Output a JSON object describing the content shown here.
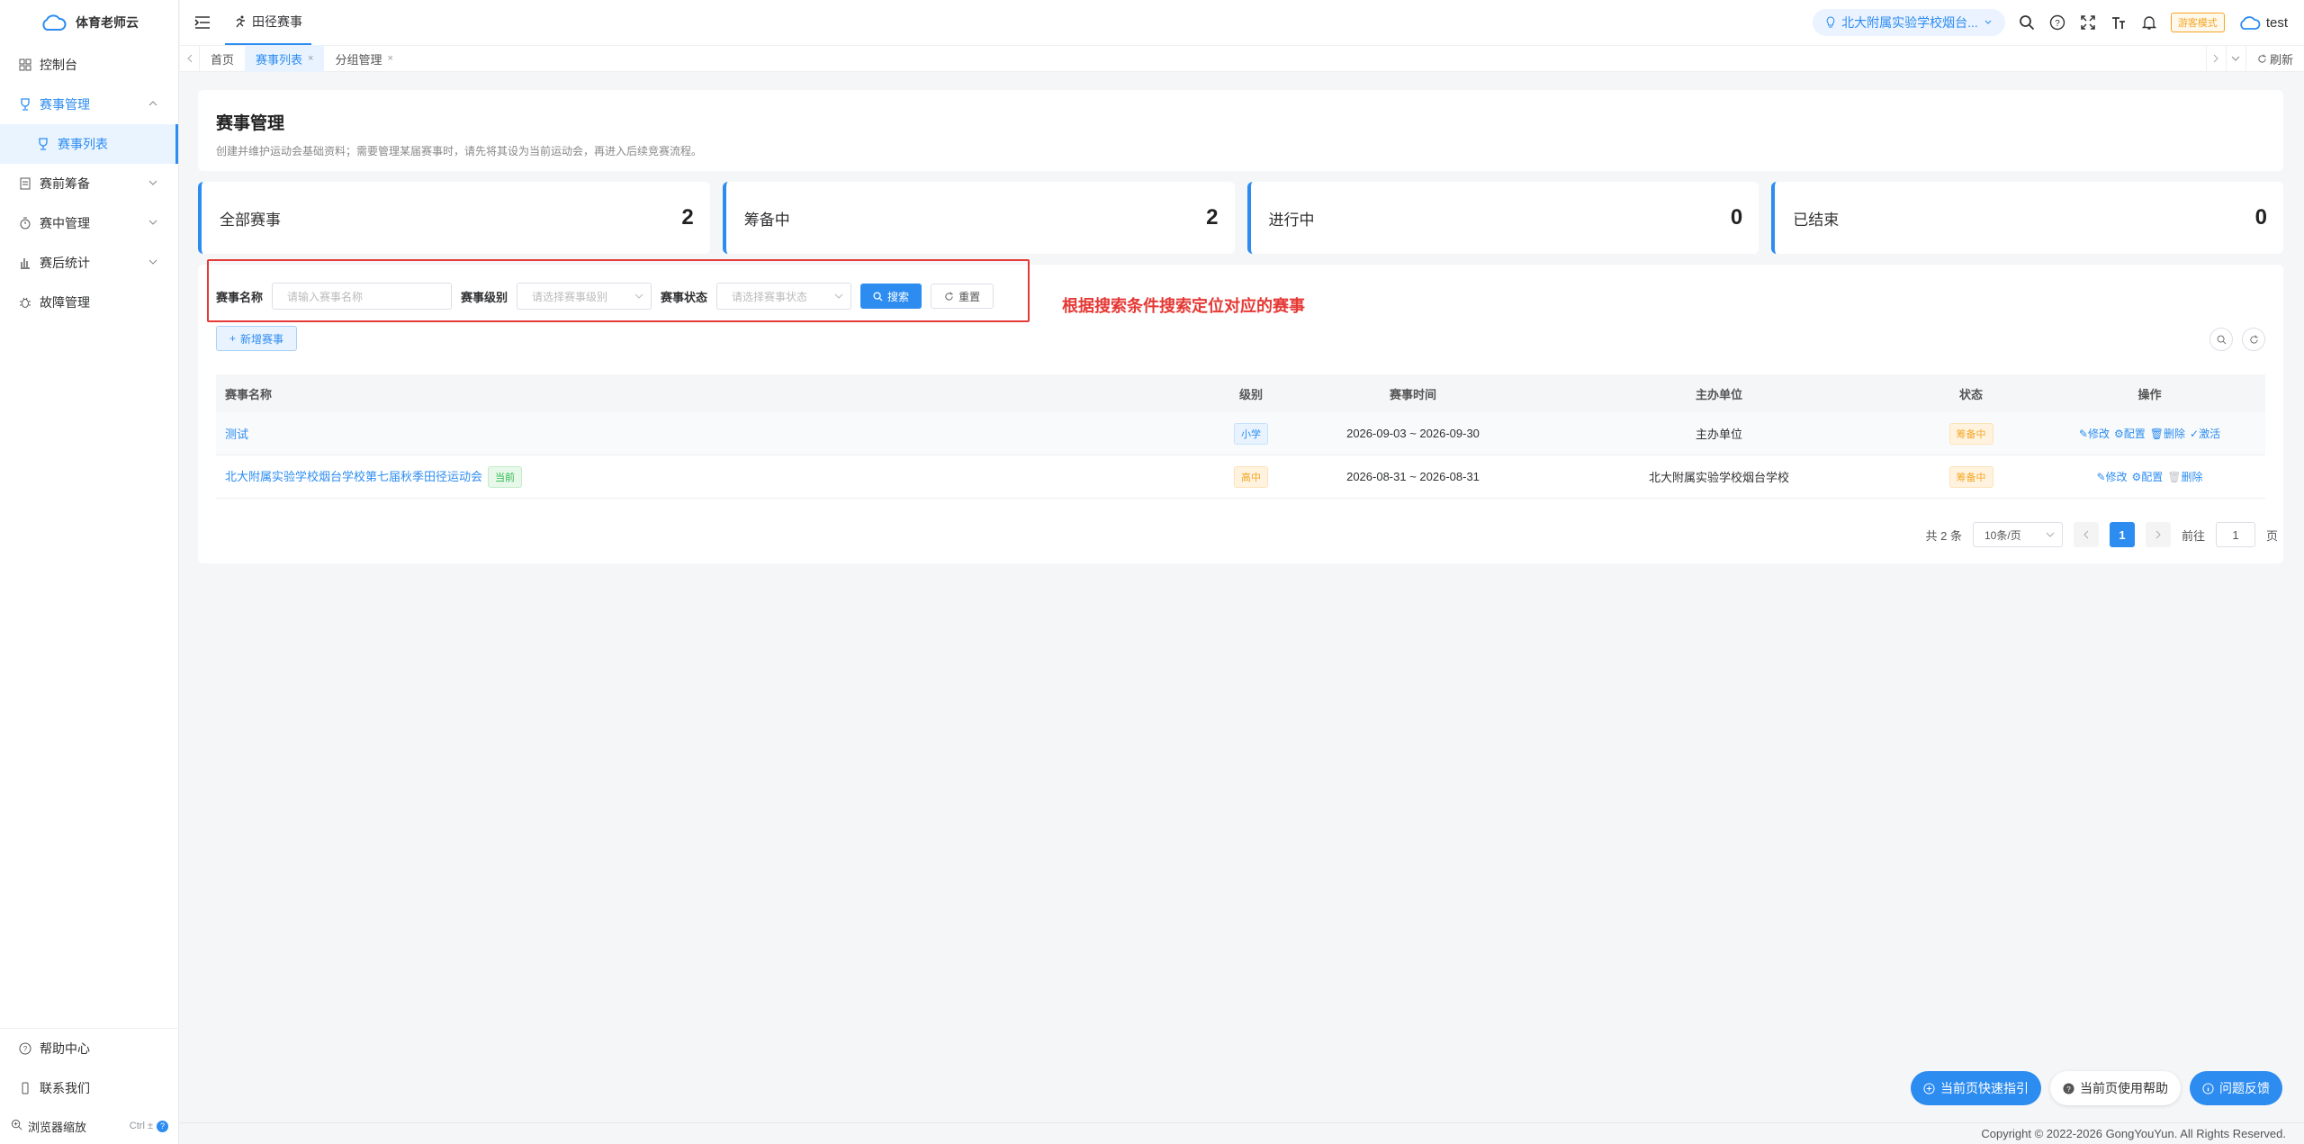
{
  "sidebar": {
    "app_name": "体育老师云",
    "items": [
      {
        "label": "控制台"
      },
      {
        "label": "赛事管理"
      },
      {
        "label": "赛事列表"
      },
      {
        "label": "赛前筹备"
      },
      {
        "label": "赛中管理"
      },
      {
        "label": "赛后统计"
      },
      {
        "label": "故障管理"
      }
    ],
    "bottom": {
      "help": "帮助中心",
      "contact": "联系我们",
      "zoom": "浏览器缩放",
      "zoom_shortcut": "Ctrl ±"
    }
  },
  "header": {
    "top_tab": "田径赛事",
    "school": "北大附属实验学校烟台...",
    "visitor_badge": "游客模式",
    "username": "test"
  },
  "tabs": {
    "items": [
      "首页",
      "赛事列表",
      "分组管理"
    ],
    "refresh": "刷新"
  },
  "page": {
    "title": "赛事管理",
    "description": "创建并维护运动会基础资料；需要管理某届赛事时，请先将其设为当前运动会，再进入后续竞赛流程。"
  },
  "stats": [
    {
      "label": "全部赛事",
      "value": "2"
    },
    {
      "label": "筹备中",
      "value": "2"
    },
    {
      "label": "进行中",
      "value": "0"
    },
    {
      "label": "已结束",
      "value": "0"
    }
  ],
  "filters": {
    "name_label": "赛事名称",
    "name_placeholder": "请输入赛事名称",
    "level_label": "赛事级别",
    "level_placeholder": "请选择赛事级别",
    "status_label": "赛事状态",
    "status_placeholder": "请选择赛事状态",
    "search_btn": "搜索",
    "reset_btn": "重置"
  },
  "annotation": "根据搜索条件搜索定位对应的赛事",
  "add_btn": "新增赛事",
  "table": {
    "columns": [
      "赛事名称",
      "级别",
      "赛事时间",
      "主办单位",
      "状态",
      "操作"
    ],
    "rows": [
      {
        "name": "测试",
        "current_tag": "",
        "level": "小学",
        "time": "2026-09-03 ~ 2026-09-30",
        "host": "主办单位",
        "status": "筹备中",
        "ops": [
          "修改",
          "配置",
          "删除",
          "激活"
        ]
      },
      {
        "name": "北大附属实验学校烟台学校第七届秋季田径运动会",
        "current_tag": "当前",
        "level": "高中",
        "time": "2026-08-31 ~ 2026-08-31",
        "host": "北大附属实验学校烟台学校",
        "status": "筹备中",
        "ops": [
          "修改",
          "配置",
          "删除"
        ]
      }
    ]
  },
  "pager": {
    "total": "共 2 条",
    "page_size": "10条/页",
    "current": "1",
    "goto_prefix": "前往",
    "goto_value": "1",
    "goto_suffix": "页"
  },
  "fabs": [
    "当前页快速指引",
    "当前页使用帮助",
    "问题反馈"
  ],
  "footer": "Copyright © 2022-2026 GongYouYun. All Rights Reserved.",
  "colors": {
    "primary": "#2d8cf0",
    "warning": "#f5a623",
    "annotation": "#e53935"
  }
}
